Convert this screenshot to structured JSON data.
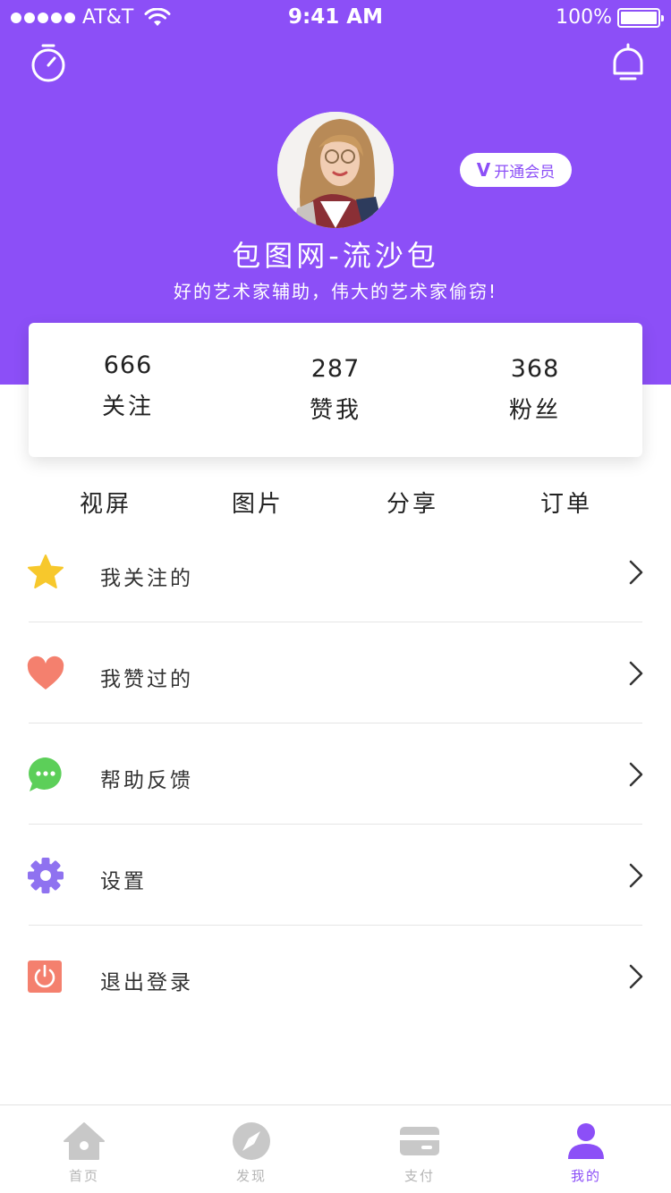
{
  "status_bar": {
    "carrier": "AT&T",
    "time": "9:41 AM",
    "battery": "100%"
  },
  "profile": {
    "vip_label": "开通会员",
    "vip_letter": "V",
    "username": "包图网-流沙包",
    "slogan": "好的艺术家辅助，伟大的艺术家偷窃!"
  },
  "stats": [
    {
      "value": "666",
      "label": "关注"
    },
    {
      "value": "287",
      "label": "赞我"
    },
    {
      "value": "368",
      "label": "粉丝"
    }
  ],
  "tabs": [
    "视屏",
    "图片",
    "分享",
    "订单"
  ],
  "menu": [
    {
      "label": "我关注的",
      "icon": "star-icon",
      "color": "#f7c82c"
    },
    {
      "label": "我赞过的",
      "icon": "heart-icon",
      "color": "#f4806e"
    },
    {
      "label": "帮助反馈",
      "icon": "chat-bubble-icon",
      "color": "#5ccf59"
    },
    {
      "label": "设置",
      "icon": "gear-icon",
      "color": "#8f72f0"
    },
    {
      "label": "退出登录",
      "icon": "power-icon",
      "color": "#f4806e"
    }
  ],
  "tab_bar": [
    {
      "label": "首页",
      "icon": "home-icon",
      "active": false
    },
    {
      "label": "发现",
      "icon": "compass-icon",
      "active": false
    },
    {
      "label": "支付",
      "icon": "card-icon",
      "active": false
    },
    {
      "label": "我的",
      "icon": "user-icon",
      "active": true
    }
  ],
  "colors": {
    "brand": "#8c4ff7",
    "inactive": "#b5b5b5"
  }
}
